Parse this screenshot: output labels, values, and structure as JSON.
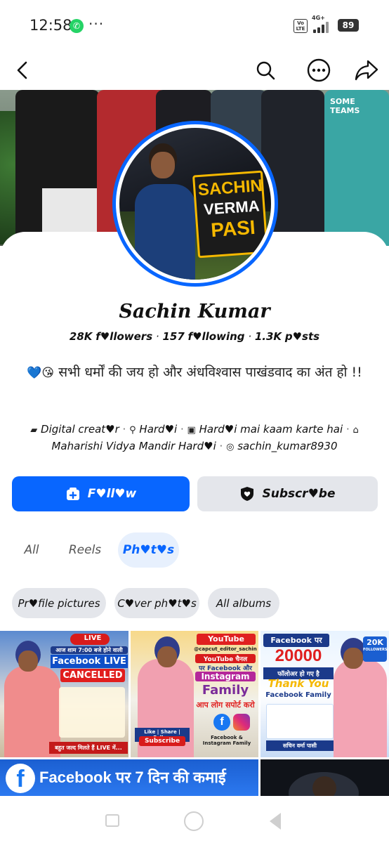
{
  "status_bar": {
    "time": "12:58",
    "more": "···",
    "volte": "Vo LTE",
    "network": "4G+",
    "battery": "89"
  },
  "nav": {
    "back_icon": "chevron-left-icon",
    "search_icon": "search-icon",
    "more_icon": "more-horizontal-icon",
    "share_icon": "share-icon"
  },
  "cover": {
    "shirt_text": "SOME TEAMS"
  },
  "avatar": {
    "line1": "SACHIN",
    "line2": "VERMA",
    "line3": "PASI"
  },
  "profile": {
    "name": "Sachin Kumar",
    "followers": "28K",
    "followers_label": "f♥llowers",
    "following": "157",
    "following_label": "f♥llowing",
    "posts": "1.3K",
    "posts_label": "p♥sts",
    "bio_emoji": "💙😘",
    "bio": "सभी धर्मों की जय हो और अंधविश्वास पाखंडवाद का अंत हो !!",
    "details": {
      "category": "Digital creat♥r",
      "location": "Hard♥i",
      "work": "Hard♥i mai kaam karte hai",
      "school": "Maharishi Vidya Mandir Hard♥i",
      "instagram": "sachin_kumar8930"
    }
  },
  "buttons": {
    "follow": "F♥ll♥w",
    "subscribe": "Subscr♥be"
  },
  "tabs": [
    {
      "label": "All",
      "active": false
    },
    {
      "label": "Reels",
      "active": false
    },
    {
      "label": "Ph♥t♥s",
      "active": true
    }
  ],
  "chips": [
    {
      "label": "Pr♥file pictures"
    },
    {
      "label": "C♥ver ph♥t♥s"
    },
    {
      "label": "All albums"
    }
  ],
  "photos": {
    "t1": {
      "badge": "LIVE",
      "line1": "आज शाम 7:00 बजे होने वाली",
      "line2": "Facebook LIVE",
      "line3": "CANCELLED",
      "line4": "बहुत जल्द मिलते हैं LIVE में..."
    },
    "t2": {
      "yt": "YouTube",
      "handle": "@capcut_editor_sachin",
      "line1": "YouTube चैनल",
      "line2": "पर Facebook और",
      "line3": "Instagram",
      "line4": "Family",
      "line5": "आप लोग सपोर्ट करो",
      "cta": "Like | Share | Follow",
      "sub": "Subscribe",
      "footer": "Facebook & Instagram Family"
    },
    "t3": {
      "line1": "Facebook पर",
      "line2": "20000",
      "line3": "फॉलोअर हो गए है",
      "line4": "Thank You",
      "line5": "Facebook Family",
      "badge": "20K",
      "badge_sub": "FOLLOWERS",
      "sign": "सचिन वर्मा पासी"
    },
    "t4": {
      "line1": "Facebook पर 7 दिन की कमाई"
    }
  }
}
